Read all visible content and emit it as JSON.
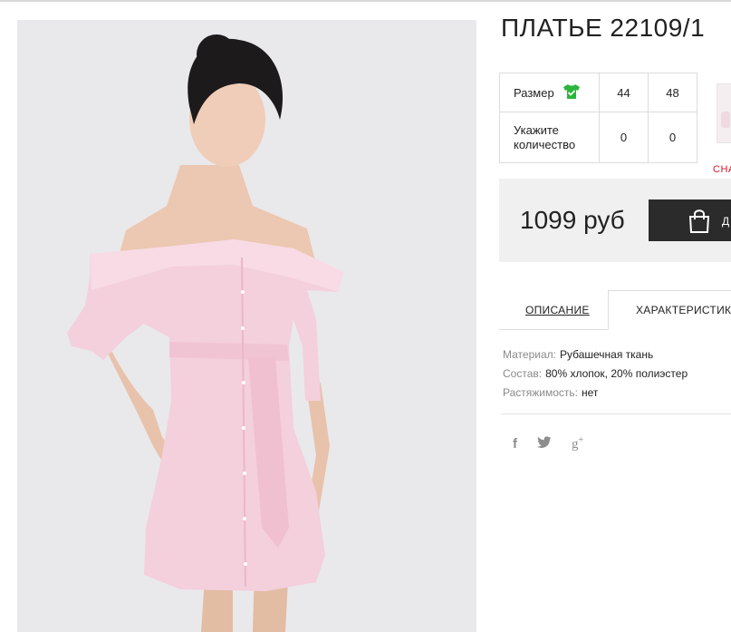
{
  "product": {
    "title": "ПЛАТЬЕ 22109/1",
    "image_alt": "Pink off-shoulder shirt dress with belt"
  },
  "sizes": {
    "size_label": "Размер",
    "size_icon": "shirt-check-icon",
    "size_icon_color": "#2bb53c",
    "values": [
      "44",
      "48"
    ],
    "quantity_label": "Укажите количество",
    "quantities": [
      "0",
      "0"
    ]
  },
  "promo_text": "СНА",
  "price": {
    "value": "1099 руб",
    "buy_label": "Д",
    "buy_icon": "shopping-bag-icon"
  },
  "tabs": {
    "description": "ОПИСАНИЕ",
    "characteristics": "ХАРАКТЕРИСТИКИ"
  },
  "specs": [
    {
      "key": "Материал:",
      "value": "Рубашечная ткань"
    },
    {
      "key": "Состав:",
      "value": "80% хлопок, 20% полиэстер"
    },
    {
      "key": "Растяжимость:",
      "value": "нет"
    }
  ],
  "social": [
    "facebook-icon",
    "twitter-icon",
    "google-plus-icon"
  ],
  "colors": {
    "accent_red": "#d6182a",
    "button_dark": "#2b2b2b",
    "price_bg": "#f0f0f0",
    "dress_pink": "#f4cfdc"
  }
}
